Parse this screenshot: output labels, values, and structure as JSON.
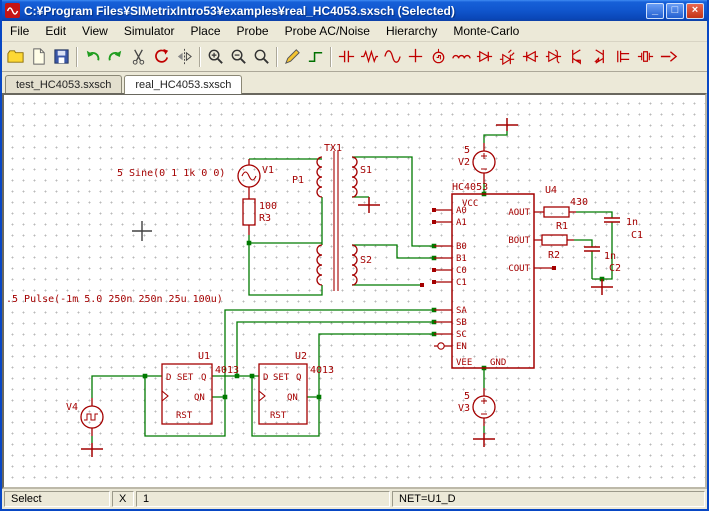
{
  "window": {
    "title": "C:¥Program Files¥SIMetrixIntro53¥examples¥real_HC4053.sxsch (Selected)",
    "minimize": "_",
    "restore": "□",
    "close": "×"
  },
  "menu": {
    "items": [
      "File",
      "Edit",
      "View",
      "Simulator",
      "Place",
      "Probe",
      "Probe AC/Noise",
      "Hierarchy",
      "Monte-Carlo"
    ]
  },
  "toolbar": {
    "buttons": [
      "open",
      "new",
      "save",
      "undo",
      "redo",
      "cut",
      "rotate",
      "mirror",
      "zoom-in",
      "zoom-out",
      "zoom-fit",
      "probe-pen",
      "wire-mode",
      "capacitor",
      "resistor",
      "sine-source",
      "ground",
      "clock-source",
      "inductor",
      "diode",
      "led",
      "diode-left",
      "zener",
      "npn-transistor",
      "pnp-transistor",
      "nmos-transistor",
      "crystal",
      "current-arrow"
    ]
  },
  "tabs": {
    "items": [
      "test_HC4053.sxsch",
      "real_HC4053.sxsch"
    ],
    "active_index": 1
  },
  "schematic": {
    "sine_text": "5 Sine(0 1 1k 0 0)",
    "pulse_text": ".5 Pulse(-1m 5.0 250n 250n 25u 100u)",
    "v1": "V1",
    "v2": "V2",
    "v3": "V3",
    "v4": "V4",
    "v2_value": "5",
    "v3_value": "5",
    "p1": "P1",
    "tx1": "TX1",
    "s1": "S1",
    "s2": "S2",
    "r3": "R3",
    "r3_value": "100",
    "ic": {
      "part": "HC4053",
      "ref": "U4",
      "vcc": "VCC",
      "vee": "VEE",
      "gnd": "GND",
      "a0": "A0",
      "a1": "A1",
      "b0": "B0",
      "b1": "B1",
      "c0": "C0",
      "c1": "C1",
      "sa": "SA",
      "sb": "SB",
      "sc": "SC",
      "en": "EN",
      "aout": "AOUT",
      "bout": "BOUT",
      "cout": "COUT"
    },
    "u1": "U1",
    "u1_part": "4013",
    "u2": "U2",
    "u2_part": "4013",
    "ff": {
      "d": "D",
      "set": "SET",
      "q": "Q",
      "qn": "QN",
      "rst": "RST"
    },
    "r1": "R1",
    "r1_value": "430",
    "r2": "R2",
    "c1": "C1",
    "c1_value": "1n",
    "c2": "C2",
    "c2_value": "1n"
  },
  "statusbar": {
    "mode": "Select",
    "x_label": "X",
    "x_value": "1",
    "net": "NET=U1_D"
  },
  "colors": {
    "wire": "#007a00",
    "component": "#a40000",
    "titlebar": "#1157cf"
  }
}
